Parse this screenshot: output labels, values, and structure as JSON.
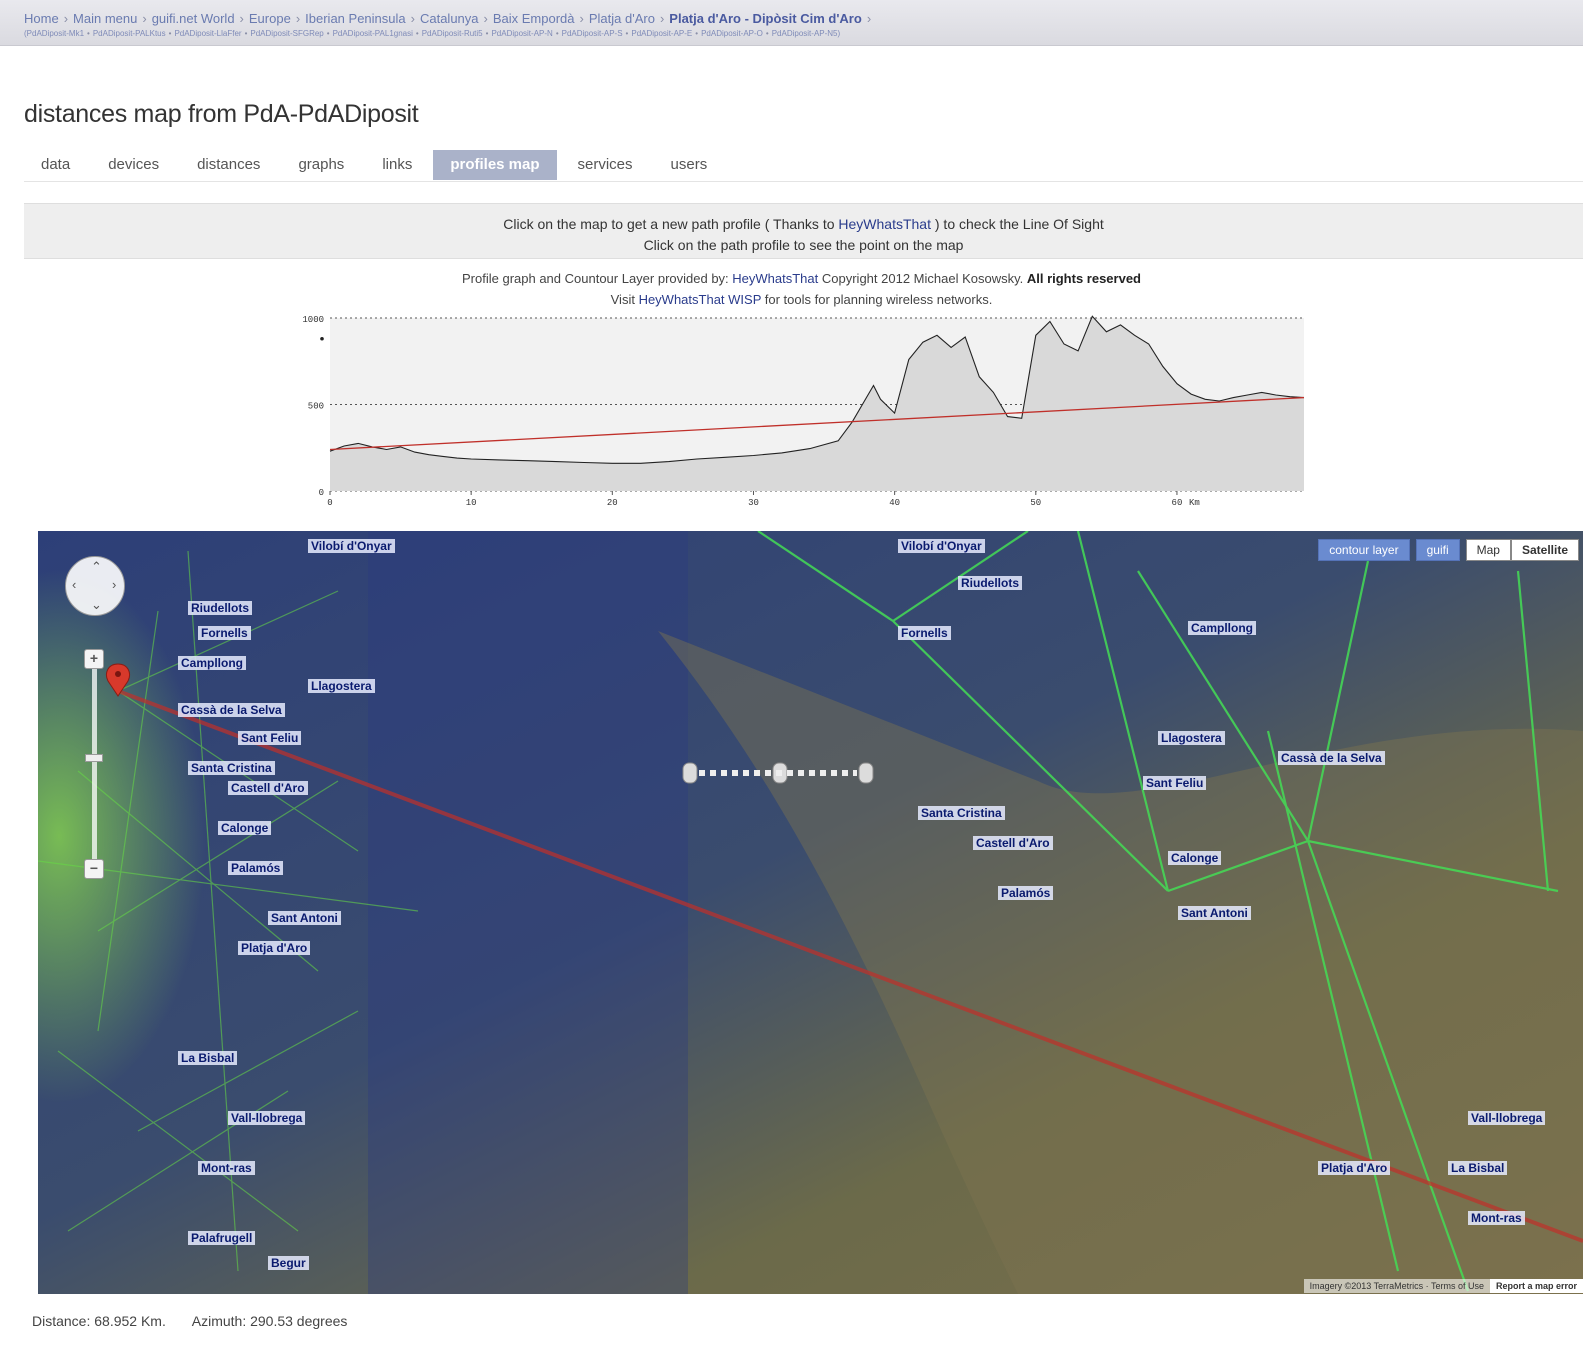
{
  "breadcrumb": {
    "items": [
      "Home",
      "Main menu",
      "guifi.net World",
      "Europe",
      "Iberian Peninsula",
      "Catalunya",
      "Baix Empordà",
      "Platja d'Aro"
    ],
    "current": "Platja d'Aro - Dipòsit Cim d'Aro",
    "devices": [
      "PdADiposit-Mk1",
      "PdADiposit-PALKtus",
      "PdADiposit-LlaFfer",
      "PdADiposit-SFGRep",
      "PdADiposit-PAL1gnasi",
      "PdADiposit-Ruti5",
      "PdADiposit-AP-N",
      "PdADiposit-AP-S",
      "PdADiposit-AP-E",
      "PdADiposit-AP-O",
      "PdADiposit-AP-N5"
    ]
  },
  "page": {
    "title": "distances map from PdA-PdADiposit"
  },
  "tabs": [
    {
      "label": "data",
      "active": false
    },
    {
      "label": "devices",
      "active": false
    },
    {
      "label": "distances",
      "active": false
    },
    {
      "label": "graphs",
      "active": false
    },
    {
      "label": "links",
      "active": false
    },
    {
      "label": "profiles map",
      "active": true
    },
    {
      "label": "services",
      "active": false
    },
    {
      "label": "users",
      "active": false
    }
  ],
  "info": {
    "line1_pre": "Click on the map to get a new path profile ( Thanks to ",
    "line1_link": "HeyWhatsThat",
    "line1_post": " ) to check the Line Of Sight",
    "line2": "Click on the path profile to see the point on the map"
  },
  "credit": {
    "line1_pre": "Profile graph and Countour Layer provided by: ",
    "line1_link": "HeyWhatsThat",
    "line1_mid": " Copyright 2012 Michael Kosowsky. ",
    "line1_bold": "All rights reserved",
    "line2_pre": "Visit ",
    "line2_link": "HeyWhatsThat WISP",
    "line2_post": " for tools for planning wireless networks."
  },
  "chart_data": {
    "type": "area",
    "title": "",
    "xlabel": "",
    "ylabel": "",
    "x_unit": "Km",
    "xlim": [
      0,
      69
    ],
    "ylim": [
      0,
      1000
    ],
    "x_ticks": [
      0,
      10,
      20,
      30,
      40,
      50,
      60
    ],
    "y_ticks": [
      0,
      500,
      1000
    ],
    "grid": "dotted horizontal at 0, 500, 1000",
    "series": [
      {
        "values": [
          [
            0,
            230
          ],
          [
            1,
            260
          ],
          [
            2,
            275
          ],
          [
            3,
            255
          ],
          [
            4,
            240
          ],
          [
            5,
            255
          ],
          [
            6,
            225
          ],
          [
            7,
            210
          ],
          [
            8,
            200
          ],
          [
            9,
            190
          ],
          [
            10,
            185
          ],
          [
            12,
            180
          ],
          [
            14,
            175
          ],
          [
            16,
            170
          ],
          [
            18,
            165
          ],
          [
            20,
            160
          ],
          [
            22,
            160
          ],
          [
            24,
            170
          ],
          [
            26,
            185
          ],
          [
            28,
            195
          ],
          [
            30,
            205
          ],
          [
            32,
            220
          ],
          [
            34,
            245
          ],
          [
            36,
            290
          ],
          [
            37,
            400
          ],
          [
            38,
            540
          ],
          [
            38.5,
            610
          ],
          [
            39,
            530
          ],
          [
            40,
            450
          ],
          [
            41,
            760
          ],
          [
            42,
            860
          ],
          [
            43,
            900
          ],
          [
            44,
            830
          ],
          [
            45,
            890
          ],
          [
            46,
            660
          ],
          [
            47,
            570
          ],
          [
            48,
            430
          ],
          [
            49,
            420
          ],
          [
            50,
            900
          ],
          [
            51,
            980
          ],
          [
            52,
            850
          ],
          [
            53,
            810
          ],
          [
            54,
            1010
          ],
          [
            55,
            920
          ],
          [
            56,
            960
          ],
          [
            57,
            900
          ],
          [
            58,
            850
          ],
          [
            59,
            720
          ],
          [
            60,
            620
          ],
          [
            61,
            560
          ],
          [
            62,
            530
          ],
          [
            63,
            520
          ],
          [
            64,
            540
          ],
          [
            65,
            555
          ],
          [
            66,
            570
          ],
          [
            67,
            555
          ],
          [
            68,
            545
          ],
          [
            69,
            540
          ]
        ]
      },
      {
        "values": [
          [
            0,
            240
          ],
          [
            69,
            540
          ]
        ],
        "color": "#c0302a"
      }
    ]
  },
  "map": {
    "controls": {
      "layer_buttons": [
        "contour layer",
        "guifi"
      ],
      "map_types": [
        "Map",
        "Satellite"
      ]
    },
    "nav_glyphs": {
      "up": "⌃",
      "down": "⌄",
      "left": "‹",
      "right": "›"
    },
    "zoom": {
      "in": "+",
      "out": "−"
    },
    "footer": {
      "copyright": "Imagery ©2013 TerraMetrics · Terms of Use",
      "report": "Report a map error"
    },
    "labels": [
      "Vilobí d'Onyar",
      "Riudellots",
      "Fornells",
      "Campllong",
      "Llagostera",
      "Cassà de la Selva",
      "Sant Feliu",
      "Santa Cristina",
      "Castell d'Aro",
      "Calonge",
      "Palamós",
      "Sant Antoni",
      "Platja d'Aro",
      "La Bisbal",
      "Vall-llobrega",
      "Mont-ras",
      "Palafrugell",
      "Begur"
    ]
  },
  "stats": {
    "distance": "Distance: 68.952 Km.",
    "azimuth": "Azimuth: 290.53 degrees"
  },
  "colors": {
    "accent_tab": "#aab2c9",
    "link": "#2a3c8c",
    "path_line": "#c0302a",
    "guifi_links": "#4cd94c"
  }
}
